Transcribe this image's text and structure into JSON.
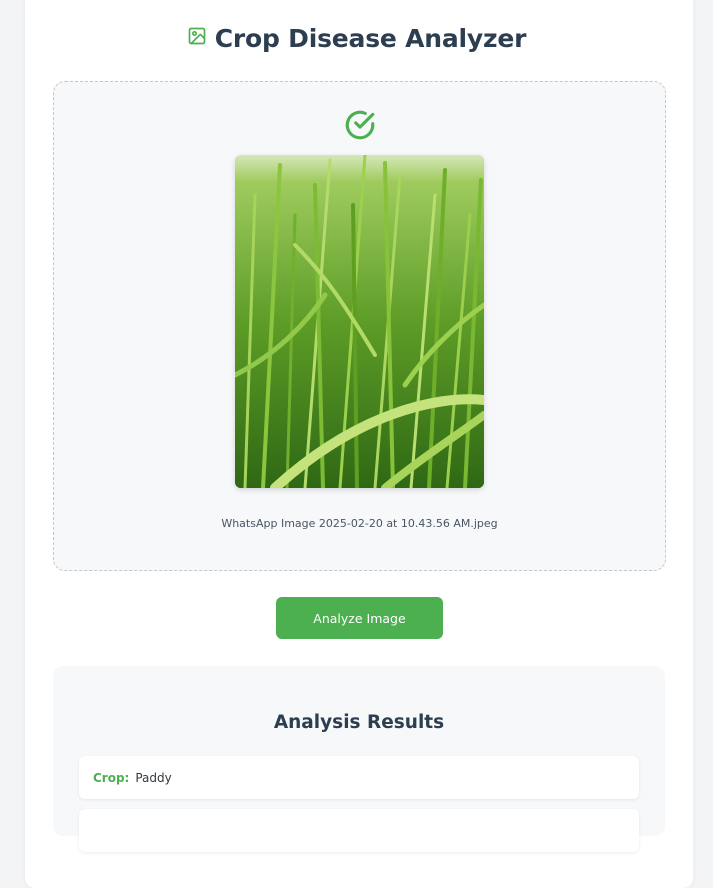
{
  "header": {
    "title": "Crop Disease Analyzer",
    "icon": "image-icon"
  },
  "upload": {
    "status_icon": "check-circle-icon",
    "file_name": "WhatsApp Image 2025-02-20 at 10.43.56 AM.jpeg"
  },
  "actions": {
    "analyze_label": "Analyze Image"
  },
  "results": {
    "title": "Analysis Results",
    "rows": [
      {
        "key": "Crop:",
        "value": "Paddy"
      },
      {
        "key": "",
        "value": ""
      }
    ]
  },
  "colors": {
    "accent": "#4caf50",
    "title_text": "#2c3e50"
  }
}
